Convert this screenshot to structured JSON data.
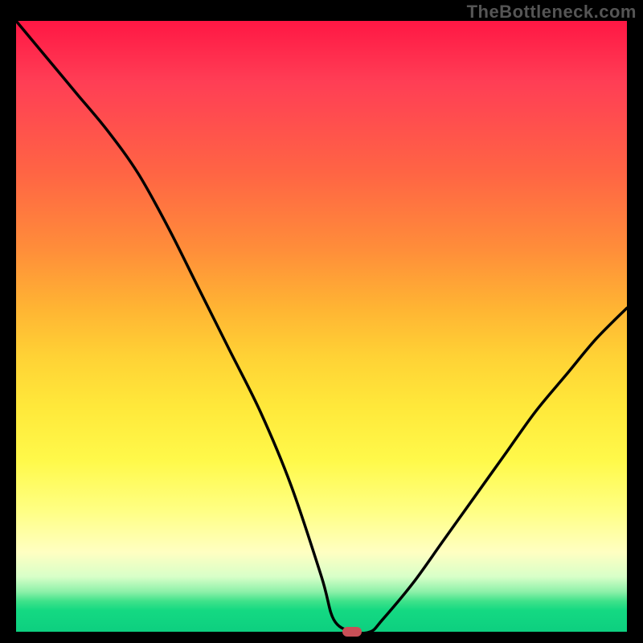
{
  "watermark": "TheBottleneck.com",
  "chart_data": {
    "type": "line",
    "title": "",
    "xlabel": "",
    "ylabel": "",
    "xlim": [
      0,
      100
    ],
    "ylim": [
      0,
      100
    ],
    "grid": false,
    "legend": false,
    "notes": "V-shaped bottleneck curve over rainbow gradient background (red at top = high bottleneck, green at bottom = 0%). Minimum near x≈55.",
    "series": [
      {
        "name": "bottleneck-curve",
        "x": [
          0,
          5,
          10,
          15,
          20,
          25,
          30,
          35,
          40,
          45,
          50,
          52,
          55,
          58,
          60,
          65,
          70,
          75,
          80,
          85,
          90,
          95,
          100
        ],
        "values": [
          100,
          94,
          88,
          82,
          75,
          66,
          56,
          46,
          36,
          24,
          9,
          2,
          0,
          0,
          2,
          8,
          15,
          22,
          29,
          36,
          42,
          48,
          53
        ]
      }
    ],
    "marker": {
      "x": 55,
      "y": 0,
      "color": "#c94f57"
    },
    "gradient_stops": [
      {
        "pos": 0,
        "color": "#ff1744"
      },
      {
        "pos": 10,
        "color": "#ff3e55"
      },
      {
        "pos": 25,
        "color": "#ff6544"
      },
      {
        "pos": 37,
        "color": "#ff8c3a"
      },
      {
        "pos": 47,
        "color": "#ffb433"
      },
      {
        "pos": 55,
        "color": "#ffd235"
      },
      {
        "pos": 63,
        "color": "#ffe83a"
      },
      {
        "pos": 72,
        "color": "#fff94a"
      },
      {
        "pos": 80,
        "color": "#ffff82"
      },
      {
        "pos": 87,
        "color": "#ffffc2"
      },
      {
        "pos": 91,
        "color": "#d8ffc8"
      },
      {
        "pos": 93.5,
        "color": "#8bf0a8"
      },
      {
        "pos": 95,
        "color": "#3fe28a"
      },
      {
        "pos": 96.5,
        "color": "#14d982"
      },
      {
        "pos": 100,
        "color": "#0dcf80"
      }
    ]
  }
}
